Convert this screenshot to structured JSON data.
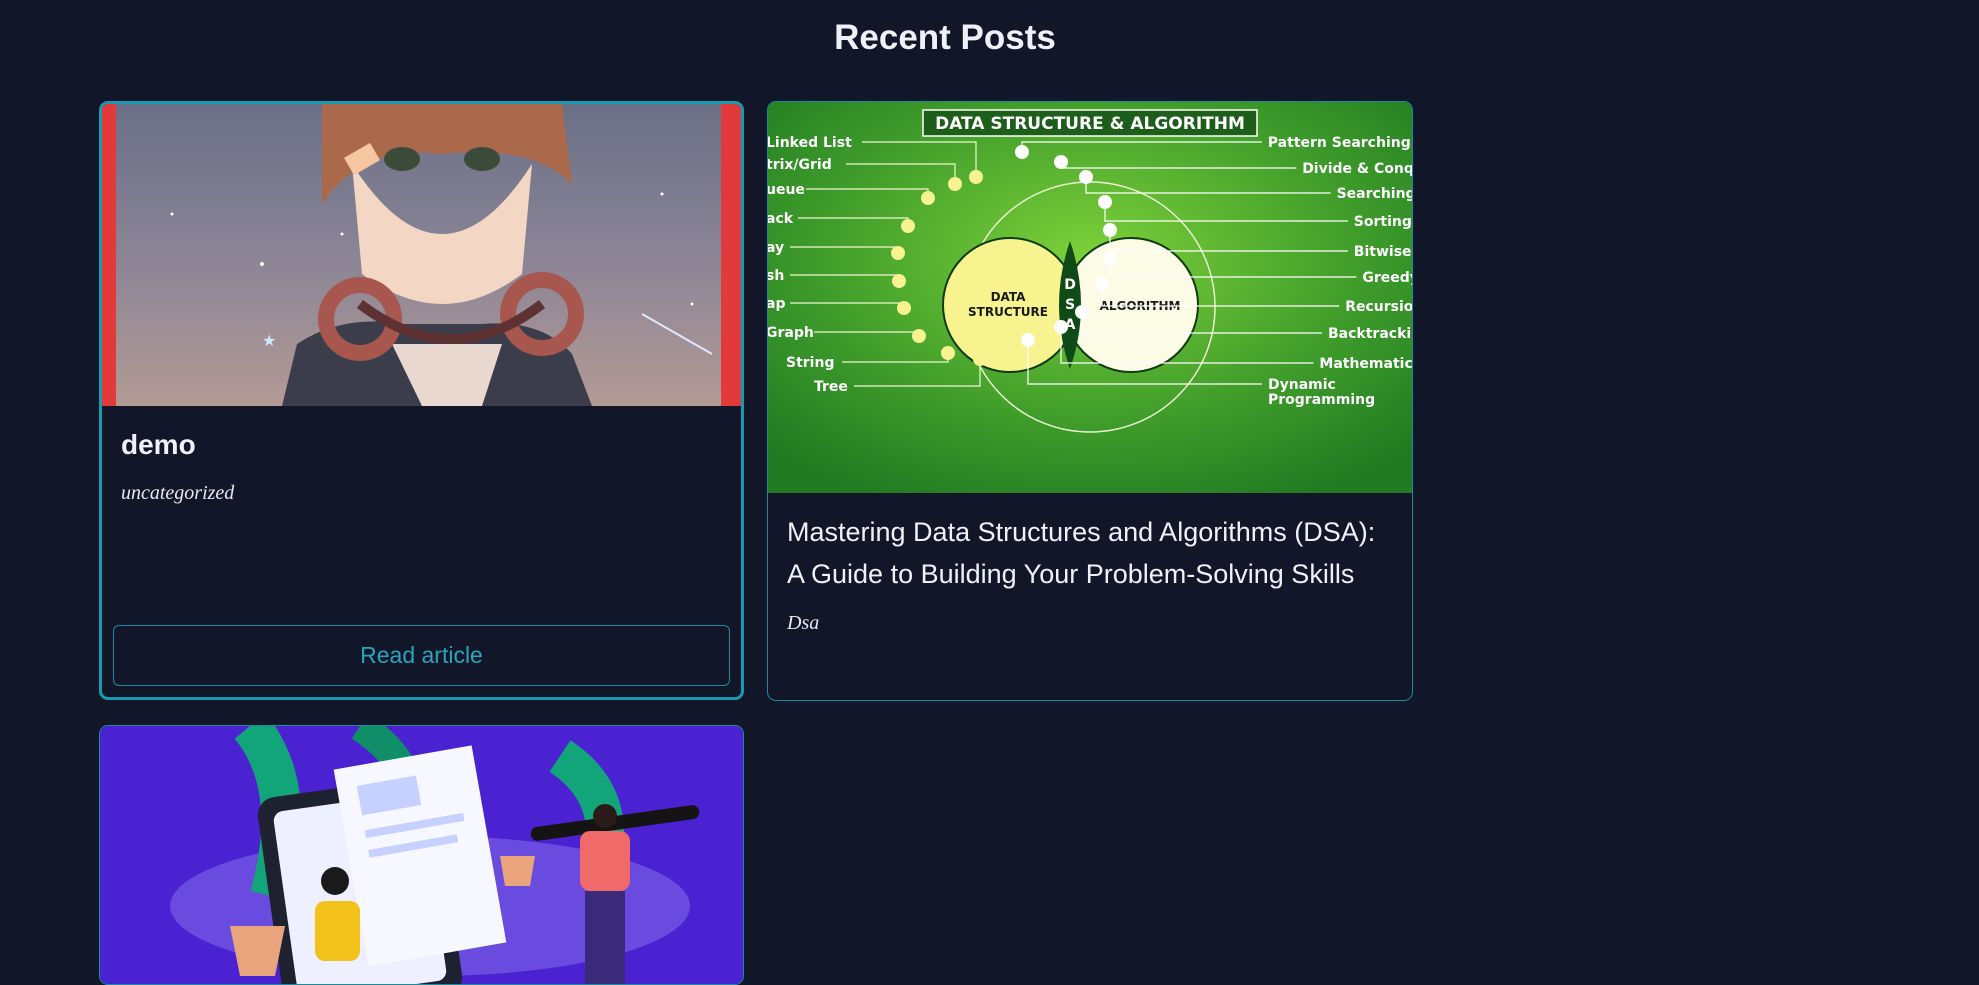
{
  "section": {
    "title": "Recent Posts"
  },
  "posts": [
    {
      "title": "demo",
      "category": "uncategorized",
      "button_label": "Read article",
      "image_alt": "Anime character with headphones"
    },
    {
      "title": "Mastering Data Structures and Algorithms (DSA): A Guide to Building Your Problem-Solving Skills",
      "title_line1": "Mastering Data Structures and Algorithms (DSA):",
      "title_line2": "A Guide to Building Your Problem-Solving Skills",
      "category": "Dsa",
      "image": {
        "banner": "DATA STRUCTURE & ALGORITHM",
        "left_circle": [
          "DATA",
          "STRUCTURE"
        ],
        "middle": [
          "D",
          "S",
          "A"
        ],
        "right_circle": "ALGORITHM",
        "left_labels": [
          "Linked List",
          "trix/Grid",
          "ueue",
          "ack",
          "ay",
          "sh",
          "ap",
          "Graph",
          "String",
          "Tree"
        ],
        "right_labels": [
          "Pattern Searching",
          "Divide & Conq",
          "Searching",
          "Sorting",
          "Bitwise",
          "Greedy",
          "Recursio",
          "Backtracki",
          "Mathematica",
          "Dynamic",
          "Programming"
        ]
      }
    },
    {
      "title": "",
      "image_alt": "Illustration of people with documents"
    }
  ]
}
